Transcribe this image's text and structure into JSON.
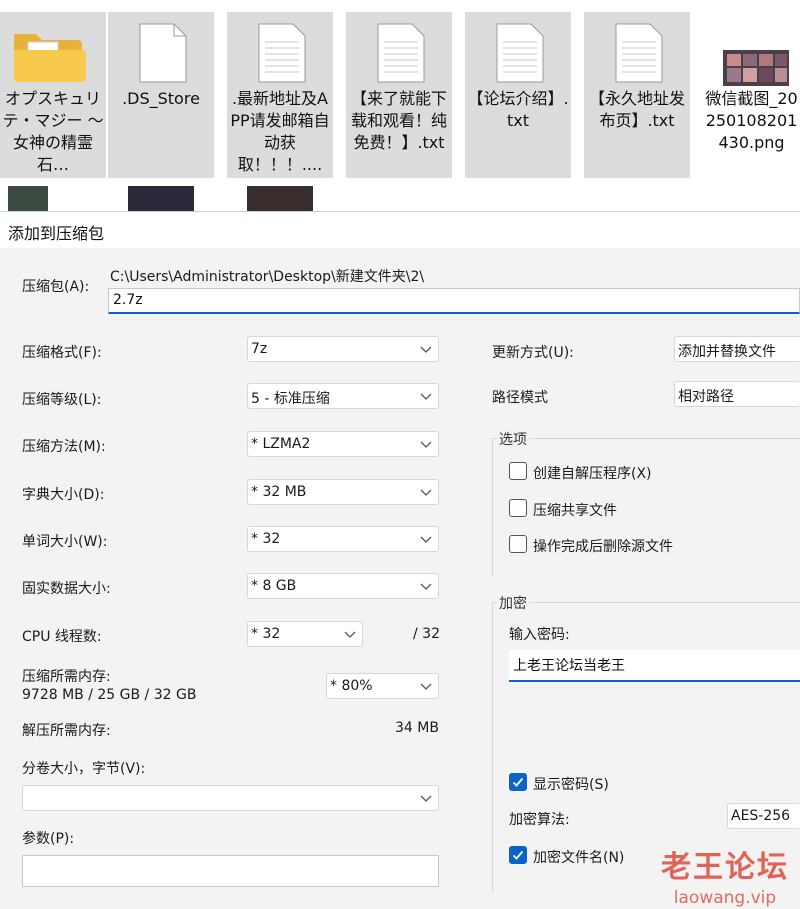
{
  "desktop": {
    "files": [
      {
        "name": "オプスキュリテ・マジー ～ 女神の精霊石…",
        "icon": "folder-icon"
      },
      {
        "name": ".DS_Store",
        "icon": "file-icon"
      },
      {
        "name": ".最新地址及APP请发邮箱自动获取！！！....",
        "icon": "text-file-icon"
      },
      {
        "name": "【来了就能下载和观看！纯免费！】.txt",
        "icon": "text-file-icon"
      },
      {
        "name": "【论坛介绍】.txt",
        "icon": "text-file-icon"
      },
      {
        "name": "【永久地址发布页】.txt",
        "icon": "text-file-icon"
      },
      {
        "name": "微信截图_20250108201430.png",
        "icon": "image-file-icon"
      }
    ]
  },
  "dialog": {
    "title": "添加到压缩包",
    "archive_label": "压缩包(A):",
    "archive_path": "C:\\Users\\Administrator\\Desktop\\新建文件夹\\2\\",
    "archive_name": "2.7z",
    "left": {
      "format_label": "压缩格式(F):",
      "format_value": "7z",
      "level_label": "压缩等级(L):",
      "level_value": "5 - 标准压缩",
      "method_label": "压缩方法(M):",
      "method_value": "*  LZMA2",
      "dict_label": "字典大小(D):",
      "dict_value": "*  32 MB",
      "word_label": "单词大小(W):",
      "word_value": "*  32",
      "solid_label": "固实数据大小:",
      "solid_value": "*  8 GB",
      "threads_label": "CPU 线程数:",
      "threads_value": "*  32",
      "threads_max": "/ 32",
      "mem_comp_label": "压缩所需内存:",
      "mem_comp_value": "9728 MB / 25 GB / 32 GB",
      "mem_percent": "*  80%",
      "mem_decomp_label": "解压所需内存:",
      "mem_decomp_value": "34 MB",
      "split_label": "分卷大小，字节(V):",
      "split_value": "",
      "params_label": "参数(P):",
      "params_value": ""
    },
    "right": {
      "update_label": "更新方式(U):",
      "update_value": "添加并替换文件",
      "path_label": "路径模式",
      "path_value": "相对路径",
      "options_title": "选项",
      "opt_sfx": "创建自解压程序(X)",
      "opt_shared": "压缩共享文件",
      "opt_delete": "操作完成后删除源文件",
      "encrypt_title": "加密",
      "password_label": "输入密码:",
      "password_value": "上老王论坛当老王",
      "show_password": "显示密码(S)",
      "method_label": "加密算法:",
      "method_value": "AES-256",
      "encrypt_names": "加密文件名(N)"
    }
  },
  "watermark": {
    "title": "老王论坛",
    "url": "laowang.vip",
    "color": "#e04a3a"
  },
  "colors": {
    "accent": "#0a64c8",
    "dialog_bg": "#f3f3f3",
    "tile_bg": "#dcdcdc"
  }
}
